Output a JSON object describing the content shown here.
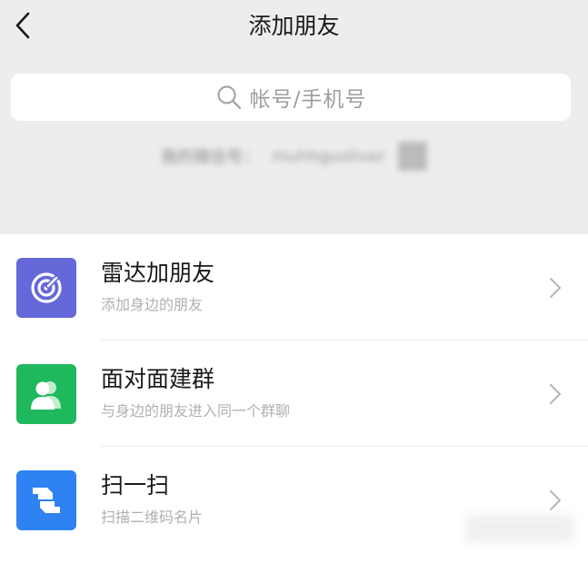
{
  "header": {
    "title": "添加朋友",
    "back_icon": "chevron-left-icon"
  },
  "search": {
    "placeholder": "帐号/手机号",
    "icon": "search-icon"
  },
  "my_account": {
    "label": "我的微信号：",
    "value": "muhhguoliver",
    "qr_icon": "qr-code-icon"
  },
  "items": [
    {
      "title": "雷达加朋友",
      "subtitle": "添加身边的朋友",
      "icon": "radar-icon",
      "color": "#6568d9"
    },
    {
      "title": "面对面建群",
      "subtitle": "与身边的朋友进入同一个群聊",
      "icon": "people-icon",
      "color": "#1fb85c"
    },
    {
      "title": "扫一扫",
      "subtitle": "扫描二维码名片",
      "icon": "scan-icon",
      "color": "#2f82f2"
    }
  ],
  "colors": {
    "top_background": "#ededed",
    "list_background": "#ffffff",
    "subtitle_text": "#b0b0b0"
  }
}
